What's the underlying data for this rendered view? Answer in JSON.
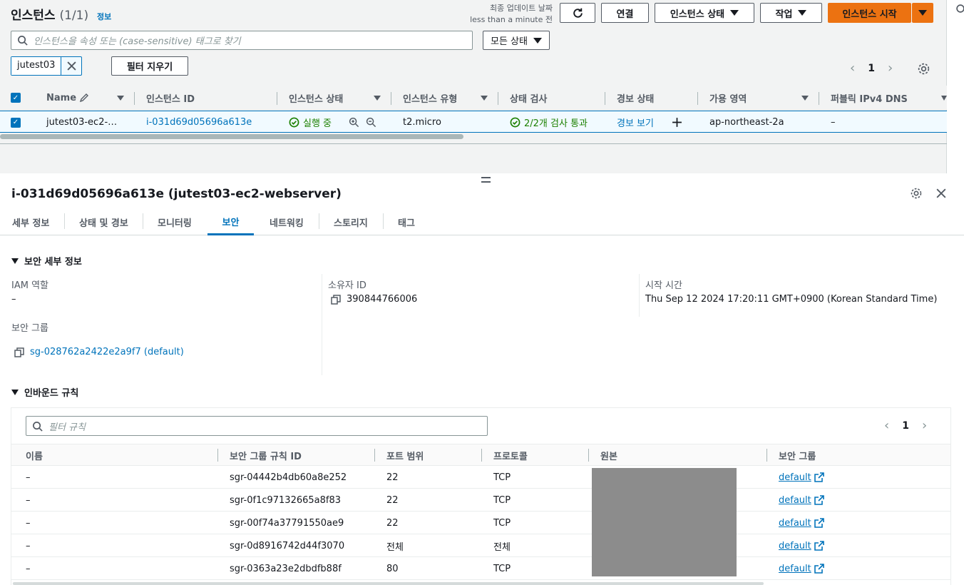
{
  "list": {
    "title": "인스턴스",
    "count": "(1/1)",
    "info_link": "정보",
    "updated_line1": "최종 업데이트 날짜",
    "updated_line2": "less than a minute 전",
    "connect_label": "연결",
    "state_label": "인스턴스 상태",
    "actions_label": "작업",
    "launch_label": "인스턴스 시작",
    "search_placeholder": "인스턴스을 속성 또는 (case-sensitive) 태그로 찾기",
    "all_states_label": "모든 상태",
    "filter_chip": "jutest03",
    "clear_filters_label": "필터 지우기",
    "page": "1",
    "columns": [
      "Name",
      "인스턴스 ID",
      "인스턴스 상태",
      "인스턴스 유형",
      "상태 검사",
      "경보 상태",
      "가용 영역",
      "퍼블릭 IPv4 DNS"
    ],
    "row": {
      "name": "jutest03-ec2-…",
      "id": "i-031d69d05696a613e",
      "state": "실행 중",
      "type": "t2.micro",
      "check": "2/2개 검사 통과",
      "alarm": "경보 보기",
      "az": "ap-northeast-2a",
      "dns": "–"
    }
  },
  "detail": {
    "title": "i-031d69d05696a613e (jutest03-ec2-webserver)",
    "tabs": [
      "세부 정보",
      "상태 및 경보",
      "모니터링",
      "보안",
      "네트워킹",
      "스토리지",
      "태그"
    ],
    "active_tab": "보안",
    "security_section": "보안 세부 정보",
    "iam_label": "IAM 역할",
    "iam_value": "–",
    "owner_label": "소유자 ID",
    "owner_value": "390844766006",
    "launch_time_label": "시작 시간",
    "launch_time_value": "Thu Sep 12 2024 17:20:11 GMT+0900 (Korean Standard Time)",
    "sg_label": "보안 그룹",
    "sg_value": "sg-028762a2422e2a9f7 (default)",
    "inbound_section": "인바운드 규칙",
    "rules_filter_placeholder": "필터 규칙",
    "rules_page": "1",
    "rules_columns": [
      "이름",
      "보안 그룹 규칙 ID",
      "포트 범위",
      "프로토콜",
      "원본",
      "보안 그룹"
    ],
    "rules": [
      {
        "name": "–",
        "id": "sgr-04442b4db60a8e252",
        "port": "22",
        "protocol": "TCP",
        "sg": "default"
      },
      {
        "name": "–",
        "id": "sgr-0f1c97132665a8f83",
        "port": "22",
        "protocol": "TCP",
        "sg": "default"
      },
      {
        "name": "–",
        "id": "sgr-00f74a37791550ae9",
        "port": "22",
        "protocol": "TCP",
        "sg": "default"
      },
      {
        "name": "–",
        "id": "sgr-0d8916742d44f3070",
        "port": "전체",
        "protocol": "전체",
        "sg": "default"
      },
      {
        "name": "–",
        "id": "sgr-0363a23e2dbdfb88f",
        "port": "80",
        "protocol": "TCP",
        "sg": "default"
      }
    ]
  },
  "colors": {
    "accent": "#0073bb",
    "primary": "#ec7211",
    "success": "#1d8102"
  },
  "icons": [
    "refresh-icon",
    "search-icon",
    "close-icon",
    "settings-icon",
    "copy-icon",
    "external-link-icon",
    "zoom-in-icon",
    "zoom-out-icon",
    "plus-icon",
    "check-circle-icon",
    "edit-icon",
    "sort-caret-icon"
  ]
}
